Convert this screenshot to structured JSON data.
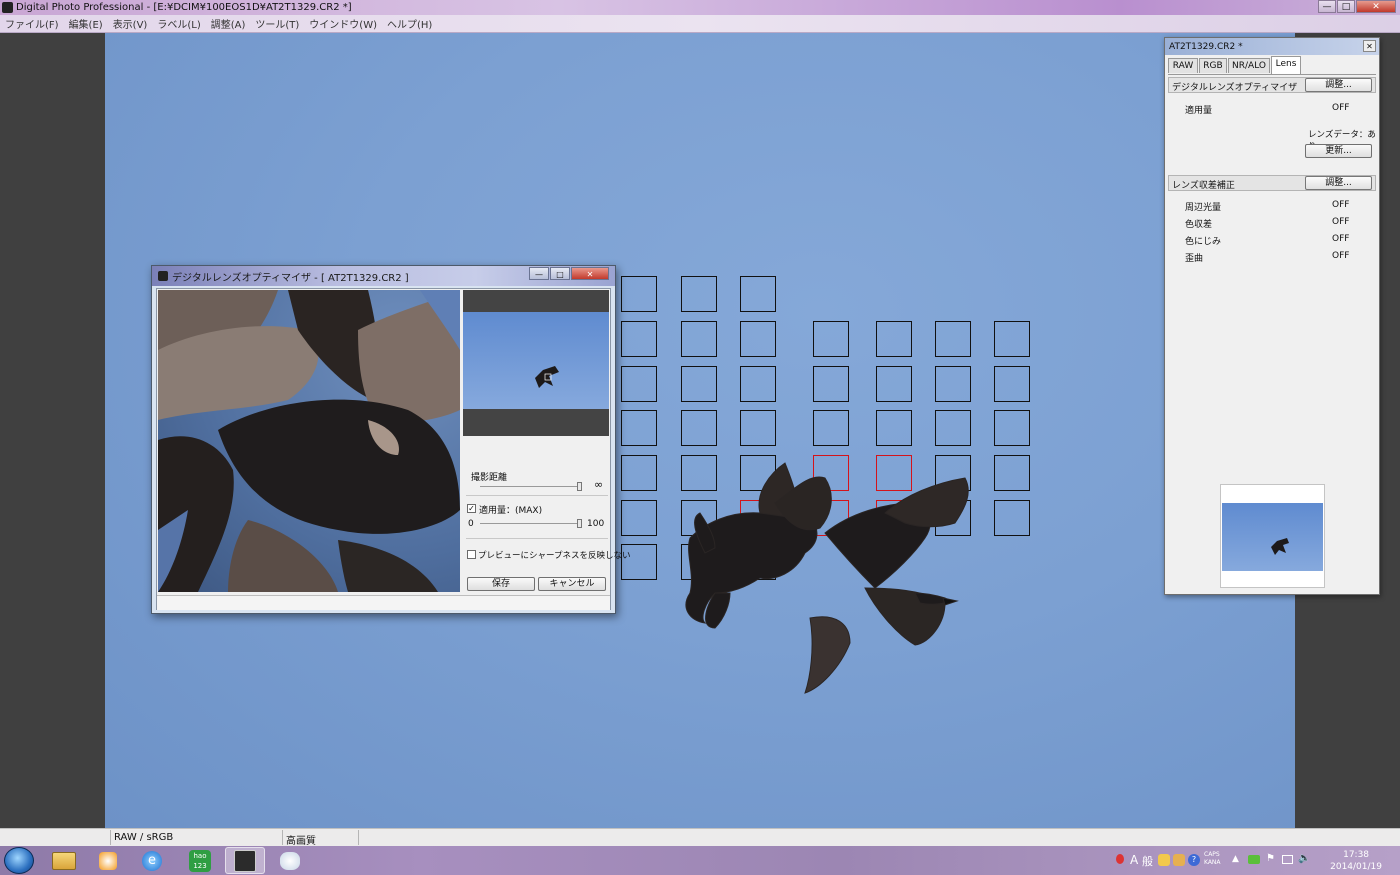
{
  "window": {
    "title": "Digital Photo Professional - [E:¥DCIM¥100EOS1D¥AT2T1329.CR2 *]"
  },
  "menu": [
    "ファイル(F)",
    "編集(E)",
    "表示(V)",
    "ラベル(L)",
    "調整(A)",
    "ツール(T)",
    "ウインドウ(W)",
    "ヘルプ(H)"
  ],
  "status": {
    "mode": "RAW / sRGB",
    "quality": "高画質"
  },
  "dialog": {
    "title": "デジタルレンズオプティマイザ - [ AT2T1329.CR2 ]",
    "distance_label": "撮影距離",
    "distance_value": "∞",
    "amount_label": "適用量：(MAX)",
    "amount_checked": true,
    "amount_min": "0",
    "amount_max": "100",
    "amount_level": 100,
    "sharpness_label": "プレビューにシャープネスを反映しない",
    "sharpness_checked": false,
    "save": "保存",
    "cancel": "キャンセル"
  },
  "palette": {
    "title": "AT2T1329.CR2 *",
    "tabs": [
      "RAW",
      "RGB",
      "NR/ALO",
      "Lens"
    ],
    "active_tab": "Lens",
    "dlo_section": {
      "label": "デジタルレンズオプティマイザ",
      "button": "調整..."
    },
    "apply_label": "適用量",
    "apply_value": "OFF",
    "lens_data": "レンズデータ：あり",
    "update_button": "更新...",
    "aberration_section": {
      "label": "レンズ収差補正",
      "button": "調整..."
    },
    "rows": [
      {
        "label": "周辺光量",
        "value": "OFF"
      },
      {
        "label": "色収差",
        "value": "OFF"
      },
      {
        "label": "色にじみ",
        "value": "OFF"
      },
      {
        "label": "歪曲",
        "value": "OFF"
      }
    ]
  },
  "clock": {
    "time": "17:38",
    "date": "2014/01/19"
  },
  "tray": {
    "ime_a": "A",
    "ime_mode": "般",
    "caps": "CAPS",
    "kana": "KANA"
  },
  "colors": {
    "af_active": "#d4141a",
    "sky": "#7ca0d2"
  }
}
